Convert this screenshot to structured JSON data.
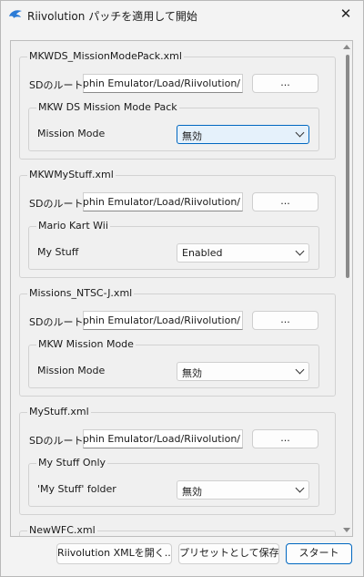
{
  "window": {
    "title": "Riivolution パッチを適用して開始",
    "close_glyph": "✕"
  },
  "sd_label": "SDのルート:",
  "sd_path": "lphin Emulator/Load/Riivolution/",
  "browse_label": "...",
  "groups": [
    {
      "title": "MKWDS_MissionModePack.xml",
      "section": "MKW DS Mission Mode Pack",
      "option": "Mission Mode",
      "value": "無効"
    },
    {
      "title": "MKWMyStuff.xml",
      "section": "Mario Kart Wii",
      "option": "My Stuff",
      "value": "Enabled"
    },
    {
      "title": "Missions_NTSC-J.xml",
      "section": "MKW Mission Mode",
      "option": "Mission Mode",
      "value": "無効"
    },
    {
      "title": "MyStuff.xml",
      "section": "My Stuff Only",
      "option": "'My Stuff' folder",
      "value": "無効"
    },
    {
      "title": "NewWFC.xml"
    }
  ],
  "footer": {
    "open_xml": "Riivolution XMLを開く...",
    "save_preset": "プリセットとして保存...",
    "start": "スタート"
  },
  "colors": {
    "accent": "#0067c0",
    "focused_select_bg": "#e5f1fb",
    "app_icon": "#2b7bd6"
  }
}
